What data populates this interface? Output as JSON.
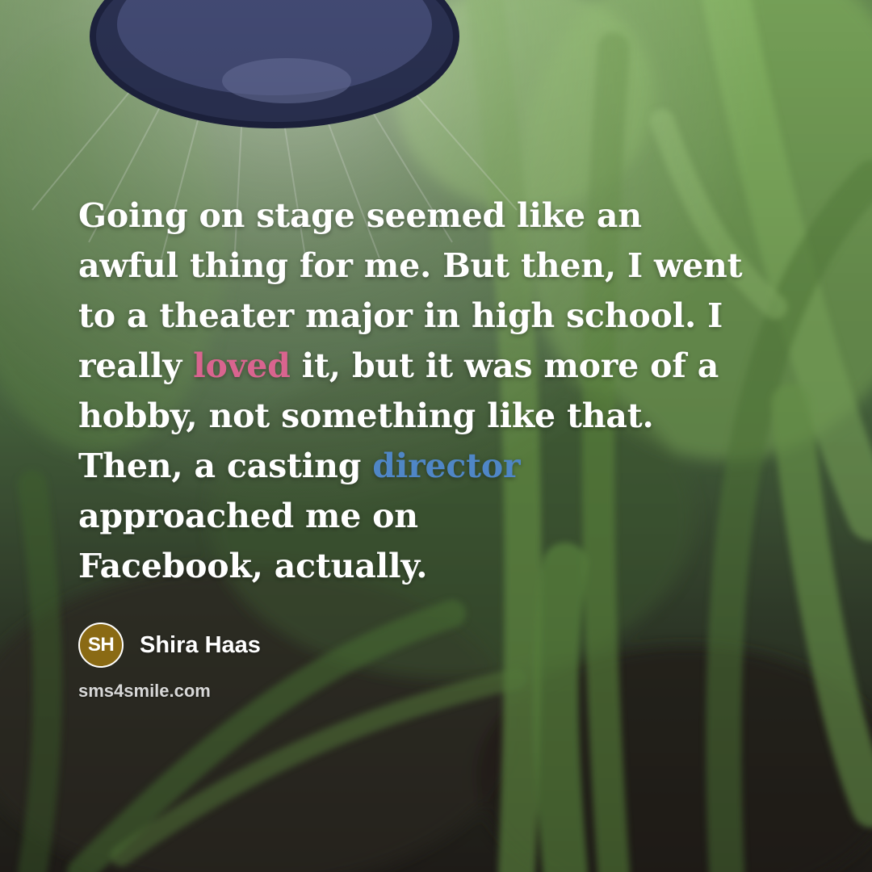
{
  "quote": {
    "lines": [
      [
        {
          "text": "Going on stage seemed like an"
        }
      ],
      [
        {
          "text": "awful thing for me. But then, I went"
        }
      ],
      [
        {
          "text": "to a theater major in high school. I"
        }
      ],
      [
        {
          "text": "really "
        },
        {
          "text": "loved",
          "highlight": "pink"
        },
        {
          "text": " it, but it was more of a"
        }
      ],
      [
        {
          "text": "hobby, not something like that."
        }
      ],
      [
        {
          "text": "Then, a casting "
        },
        {
          "text": "director",
          "highlight": "blue"
        }
      ],
      [
        {
          "text": "approached me on"
        }
      ],
      [
        {
          "text": "Facebook, actually."
        }
      ]
    ]
  },
  "author": {
    "initials": "SH",
    "name": "Shira Haas"
  },
  "site": "sms4smile.com",
  "colors": {
    "pink": "#d9648f",
    "blue": "#4f86c6",
    "gold": "#8a6a14",
    "text": "#ffffff"
  }
}
